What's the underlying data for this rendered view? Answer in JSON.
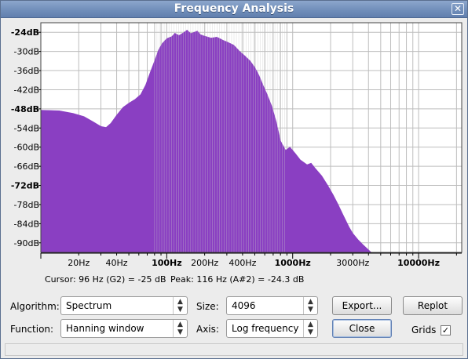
{
  "window": {
    "title": "Frequency Analysis",
    "close_glyph": "✕"
  },
  "chart_data": {
    "type": "area",
    "title": "",
    "xlabel": "",
    "ylabel": "",
    "x_scale": "log",
    "xlim": [
      10,
      22000
    ],
    "ylim": [
      -93,
      -21
    ],
    "grid": true,
    "color": "#8a3fc2",
    "y_ticks": [
      {
        "label": "-24dB",
        "value": -24,
        "bold": true
      },
      {
        "label": "-30dB",
        "value": -30,
        "bold": false
      },
      {
        "label": "-36dB",
        "value": -36,
        "bold": false
      },
      {
        "label": "-42dB",
        "value": -42,
        "bold": false
      },
      {
        "label": "-48dB",
        "value": -48,
        "bold": true
      },
      {
        "label": "-54dB",
        "value": -54,
        "bold": false
      },
      {
        "label": "-60dB",
        "value": -60,
        "bold": false
      },
      {
        "label": "-66dB",
        "value": -66,
        "bold": false
      },
      {
        "label": "-72dB",
        "value": -72,
        "bold": true
      },
      {
        "label": "-78dB",
        "value": -78,
        "bold": false
      },
      {
        "label": "-84dB",
        "value": -84,
        "bold": false
      },
      {
        "label": "-90dB",
        "value": -90,
        "bold": false
      }
    ],
    "x_ticks": [
      {
        "label": "20Hz",
        "value": 20,
        "bold": false
      },
      {
        "label": "40Hz",
        "value": 40,
        "bold": false
      },
      {
        "label": "100Hz",
        "value": 100,
        "bold": true
      },
      {
        "label": "200Hz",
        "value": 200,
        "bold": false
      },
      {
        "label": "400Hz",
        "value": 400,
        "bold": false
      },
      {
        "label": "1000Hz",
        "value": 1000,
        "bold": true
      },
      {
        "label": "3000Hz",
        "value": 3000,
        "bold": false
      },
      {
        "label": "10000Hz",
        "value": 10000,
        "bold": true
      }
    ],
    "points": [
      [
        10,
        -48.4
      ],
      [
        14,
        -48.6
      ],
      [
        18,
        -49.4
      ],
      [
        22,
        -50.4
      ],
      [
        26,
        -52
      ],
      [
        30,
        -53.5
      ],
      [
        33,
        -53.8
      ],
      [
        36,
        -52.5
      ],
      [
        40,
        -50
      ],
      [
        45,
        -47.5
      ],
      [
        50,
        -46.2
      ],
      [
        56,
        -45
      ],
      [
        62,
        -43.5
      ],
      [
        68,
        -40.5
      ],
      [
        74,
        -36.5
      ],
      [
        80,
        -33
      ],
      [
        86,
        -29.5
      ],
      [
        92,
        -27.5
      ],
      [
        100,
        -26
      ],
      [
        110,
        -25.3
      ],
      [
        116,
        -24.3
      ],
      [
        125,
        -25
      ],
      [
        135,
        -24.2
      ],
      [
        145,
        -23.3
      ],
      [
        155,
        -24.4
      ],
      [
        165,
        -24
      ],
      [
        175,
        -23.6
      ],
      [
        185,
        -24.7
      ],
      [
        200,
        -25.2
      ],
      [
        225,
        -25.8
      ],
      [
        250,
        -25.5
      ],
      [
        280,
        -26.5
      ],
      [
        300,
        -27
      ],
      [
        340,
        -28
      ],
      [
        380,
        -30
      ],
      [
        420,
        -31.5
      ],
      [
        460,
        -33
      ],
      [
        500,
        -35
      ],
      [
        540,
        -37.5
      ],
      [
        580,
        -40.5
      ],
      [
        620,
        -43
      ],
      [
        680,
        -47
      ],
      [
        740,
        -52
      ],
      [
        800,
        -58
      ],
      [
        880,
        -61
      ],
      [
        950,
        -60
      ],
      [
        1050,
        -62
      ],
      [
        1150,
        -64
      ],
      [
        1300,
        -65.5
      ],
      [
        1400,
        -65
      ],
      [
        1500,
        -66.5
      ],
      [
        1700,
        -69
      ],
      [
        1900,
        -72
      ],
      [
        2100,
        -75
      ],
      [
        2300,
        -78
      ],
      [
        2500,
        -81
      ],
      [
        2800,
        -85
      ],
      [
        3000,
        -87
      ],
      [
        3300,
        -89
      ],
      [
        3600,
        -90.5
      ],
      [
        3900,
        -91.8
      ],
      [
        4200,
        -93
      ]
    ]
  },
  "readout": {
    "cursor": "Cursor: 96 Hz (G2) = -25 dB",
    "peak": "Peak: 116 Hz (A#2) = -24.3 dB"
  },
  "controls": {
    "algorithm_label": "Algorithm:",
    "algorithm_value": "Spectrum",
    "size_label": "Size:",
    "size_value": "4096",
    "export_label": "Export...",
    "replot_label": "Replot",
    "function_label": "Function:",
    "function_value": "Hanning window",
    "axis_label": "Axis:",
    "axis_value": "Log frequency",
    "close_label": "Close",
    "grids_label": "Grids",
    "grids_checked": "✓"
  }
}
